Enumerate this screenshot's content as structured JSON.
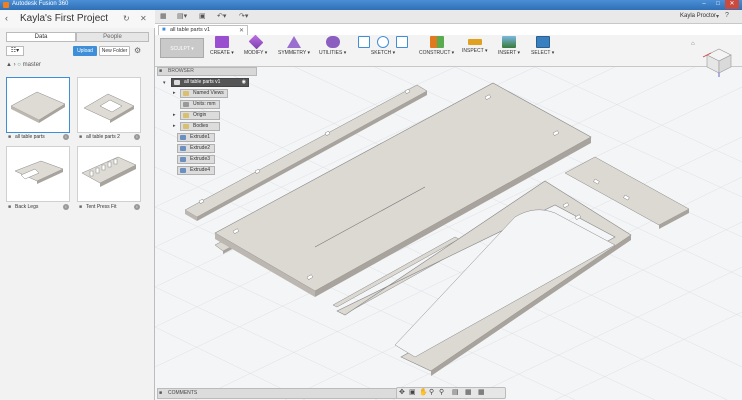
{
  "window": {
    "title": "Autodesk Fusion 360"
  },
  "data_panel": {
    "project_title": "Kayla's First Project",
    "tabs": [
      {
        "label": "Data"
      },
      {
        "label": "People"
      }
    ],
    "upload_label": "Upload",
    "new_folder_label": "New Folder",
    "branch": "master",
    "items": [
      {
        "name": "all table parts"
      },
      {
        "name": "all table parts 2"
      },
      {
        "name": "Back Legs"
      },
      {
        "name": "Tent Press Fit"
      }
    ]
  },
  "user": {
    "name": "Kayla Proctor"
  },
  "ribbon": {
    "workspace": "SCULPT",
    "groups": [
      {
        "label": "CREATE",
        "color": "#9a4fd0"
      },
      {
        "label": "MODIFY",
        "color": "#a04fc8"
      },
      {
        "label": "SYMMETRY",
        "color": "#9a6fd0"
      },
      {
        "label": "UTILITIES",
        "color": "#8a5fc0"
      },
      {
        "label": "SKETCH",
        "color": "#3f8fd8"
      },
      {
        "label": "CONSTRUCT",
        "color": "#e07a20"
      },
      {
        "label": "INSPECT",
        "color": "#e0a020"
      },
      {
        "label": "INSERT",
        "color": "#4a9ad0"
      },
      {
        "label": "SELECT",
        "color": "#3a7fc0"
      }
    ]
  },
  "browser": {
    "title": "BROWSER",
    "root": "all table parts v1",
    "nodes": [
      {
        "label": "Named Views"
      },
      {
        "label": "Units: mm"
      },
      {
        "label": "Origin"
      },
      {
        "label": "Bodies"
      },
      {
        "label": "Extrude1"
      },
      {
        "label": "Extrude2"
      },
      {
        "label": "Extrude3"
      },
      {
        "label": "Extrude4"
      }
    ]
  },
  "doc_tab": {
    "label": "all table parts v1"
  },
  "comments": {
    "label": "COMMENTS"
  },
  "colors": {
    "accent": "#3f8fd8",
    "part_top": "#dcd8d2",
    "part_side": "#a8a39c",
    "grid": "#d9dde2"
  }
}
